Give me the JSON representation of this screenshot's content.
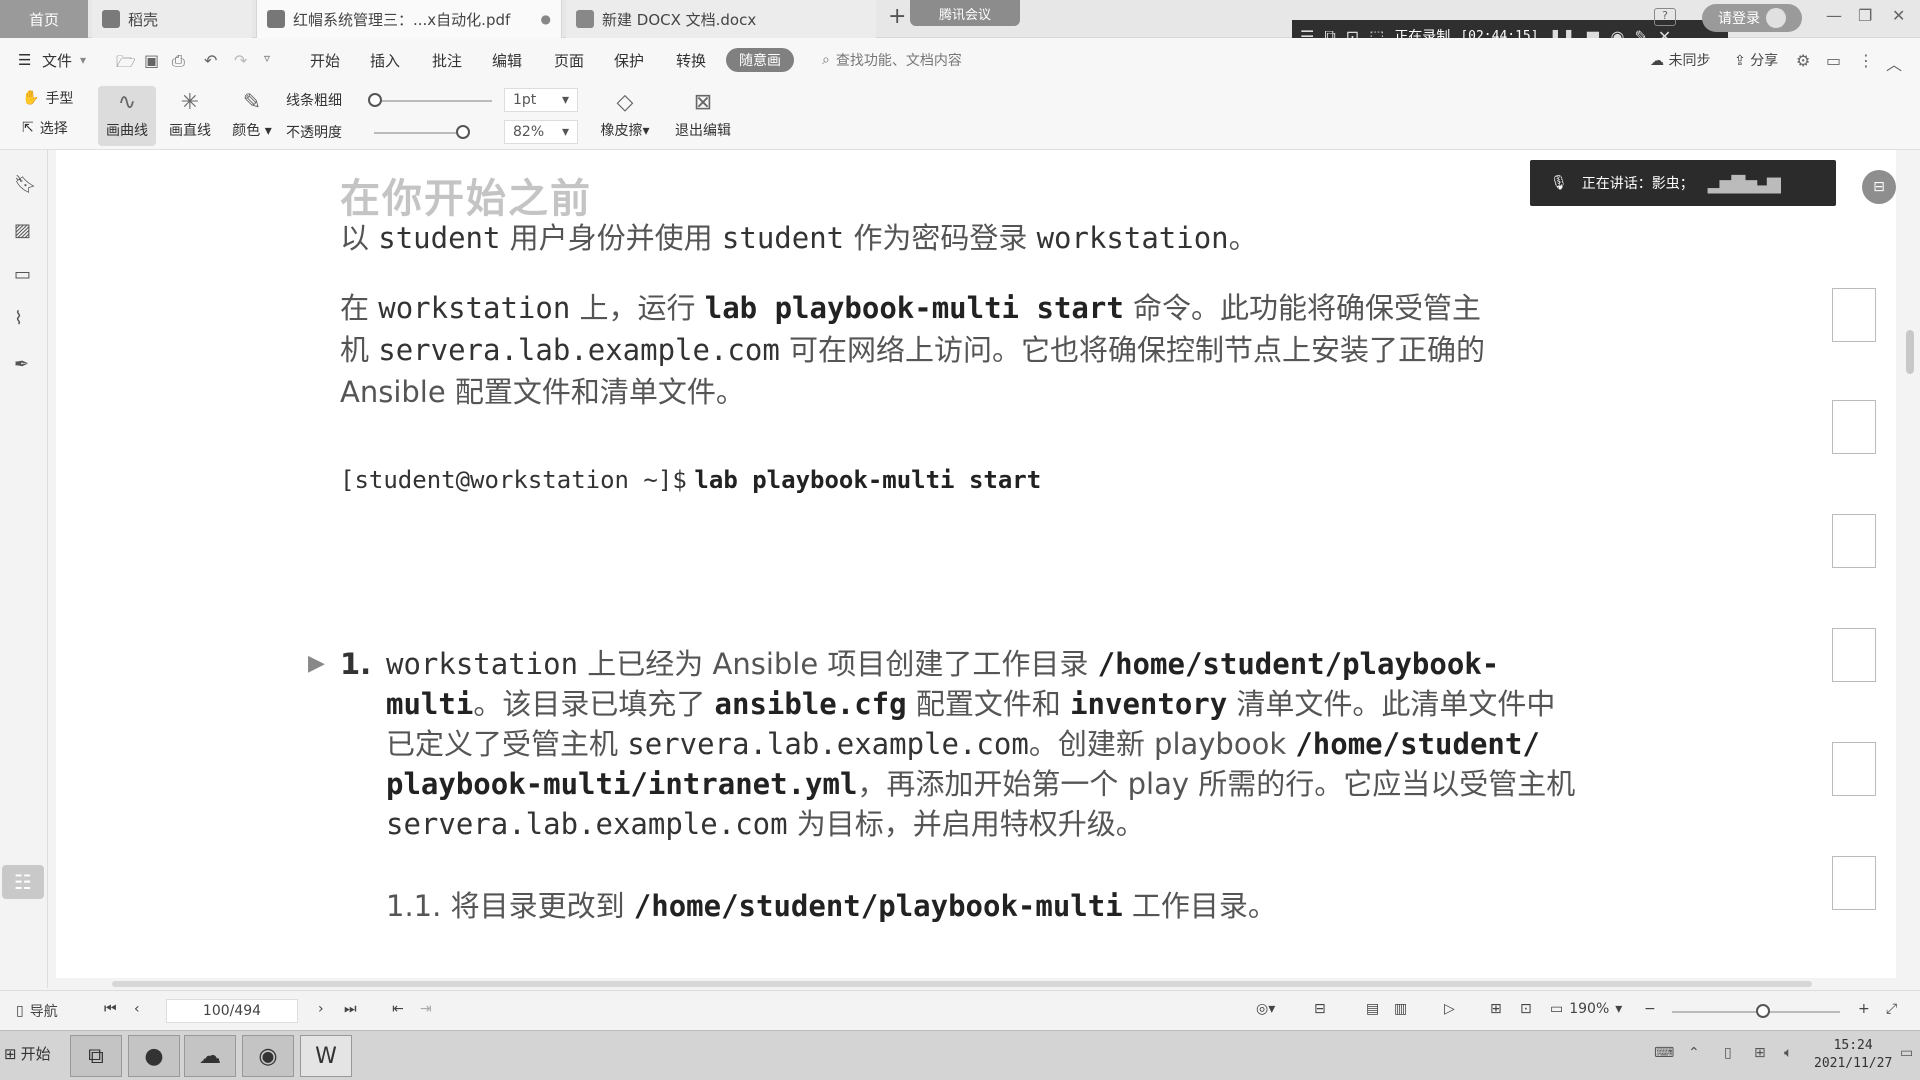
{
  "tabs": {
    "home": "首页",
    "t1": "稻壳",
    "t2": "红帽系统管理三：...x自动化.pdf",
    "t3": "新建 DOCX 文档.docx",
    "meeting": "腾讯会议"
  },
  "recording": {
    "label": "正在录制",
    "time": "[02:44:15]"
  },
  "login": "请登录",
  "menu": {
    "file": "文件",
    "items": [
      "开始",
      "插入",
      "批注",
      "编辑",
      "页面",
      "保护",
      "转换"
    ],
    "active": "随意画",
    "search_placeholder": "查找功能、文档内容",
    "sync": "未同步",
    "share": "分享"
  },
  "draw": {
    "hand": "手型",
    "select": "选择",
    "curve": "画曲线",
    "line": "画直线",
    "color": "颜色",
    "line_width": "线条粗细",
    "opacity": "不透明度",
    "width_value": "1pt",
    "opacity_value": "82%",
    "eraser": "橡皮擦",
    "exit": "退出编辑"
  },
  "speaking": {
    "label": "正在讲话：影虫；"
  },
  "doc": {
    "heading": "在你开始之前",
    "intro": {
      "a": "以",
      "b": "student",
      "c": "用户身份并使用",
      "d": "student",
      "e": "作为密码登录",
      "f": "workstation",
      "g": "。"
    },
    "para2": {
      "a": "在",
      "b": "workstation",
      "c": "上，运行",
      "d": "lab playbook-multi start",
      "e": "命令。此功能将确保受管主",
      "f": "机",
      "g": "servera.lab.example.com",
      "h": "可在网络上访问。它也将确保控制节点上安装了正确的",
      "i": "Ansible 配置文件和清单文件。"
    },
    "cmd": {
      "prompt": "[student@workstation ~]$",
      "command": "lab playbook-multi start"
    },
    "step1": {
      "num": "1.",
      "l1a": "workstation",
      "l1b": "上已经为 Ansible 项目创建了工作目录",
      "l1c": "/home/student/playbook-",
      "l2a": "multi",
      "l2b": "。该目录已填充了",
      "l2c": "ansible.cfg",
      "l2d": "配置文件和",
      "l2e": "inventory",
      "l2f": "清单文件。此清单文件中",
      "l3a": "已定义了受管主机",
      "l3b": "servera.lab.example.com",
      "l3c": "。创建新 playbook",
      "l3d": "/home/student/",
      "l4a": "playbook-multi/intranet.yml",
      "l4b": "，再添加开始第一个 play 所需的行。它应当以受管主机",
      "l5a": "servera.lab.example.com",
      "l5b": "为目标，并启用特权升级。"
    },
    "step11": {
      "num": "1.1.",
      "a": "将目录更改到",
      "b": "/home/student/playbook-multi",
      "c": "工作目录。"
    }
  },
  "status": {
    "nav": "导航",
    "page": "100/494",
    "zoom": "190%"
  },
  "taskbar": {
    "start": "开始",
    "time": "15:24",
    "date": "2021/11/27"
  }
}
